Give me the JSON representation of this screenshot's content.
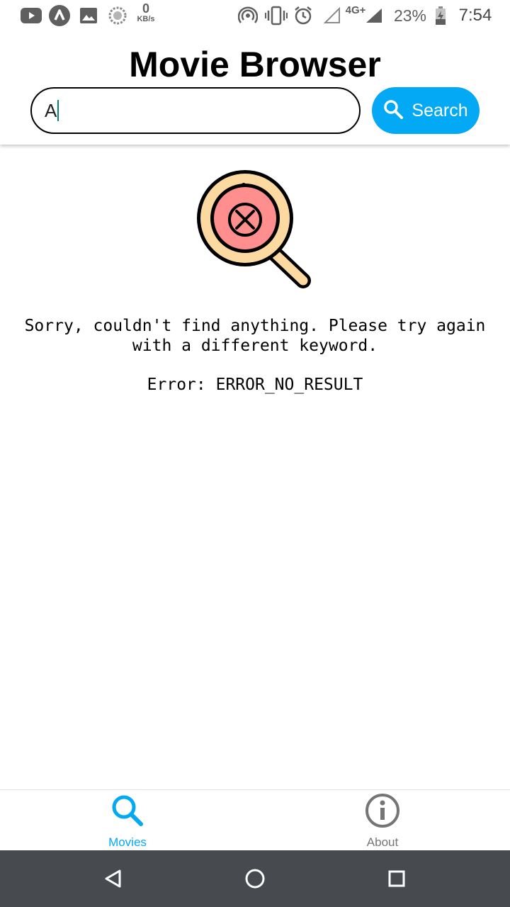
{
  "status_bar": {
    "network_speed_value": "0",
    "network_speed_unit": "KB/s",
    "network_type": "4G+",
    "battery_percent": "23%",
    "time": "7:54",
    "icons": [
      "youtube-icon",
      "a-app-icon",
      "gallery-icon",
      "sync-icon",
      "hotspot-icon",
      "vibrate-icon",
      "alarm-icon",
      "signal-empty-icon",
      "signal-icon",
      "battery-charging-icon"
    ]
  },
  "header": {
    "title": "Movie Browser",
    "search": {
      "value": "A",
      "placeholder": ""
    },
    "search_button_label": "Search"
  },
  "content": {
    "illustration_icon": "search-error-icon",
    "message": "Sorry, couldn't find anything. Please try again with a different keyword.",
    "error_code": "Error: ERROR_NO_RESULT"
  },
  "tab_bar": {
    "tabs": [
      {
        "label": "Movies",
        "icon": "search-icon",
        "active": true
      },
      {
        "label": "About",
        "icon": "info-icon",
        "active": false
      }
    ]
  },
  "nav_bar": {
    "buttons": [
      "back-icon",
      "home-icon",
      "recents-icon"
    ]
  },
  "colors": {
    "accent": "#03a9f4",
    "active_tab": "#03a9f4",
    "inactive_tab": "#757575",
    "error_fill": "#ff8f8f",
    "lens_rim": "#fcd9a1",
    "nav_bar_bg": "#474b50",
    "caret": "#008577"
  }
}
